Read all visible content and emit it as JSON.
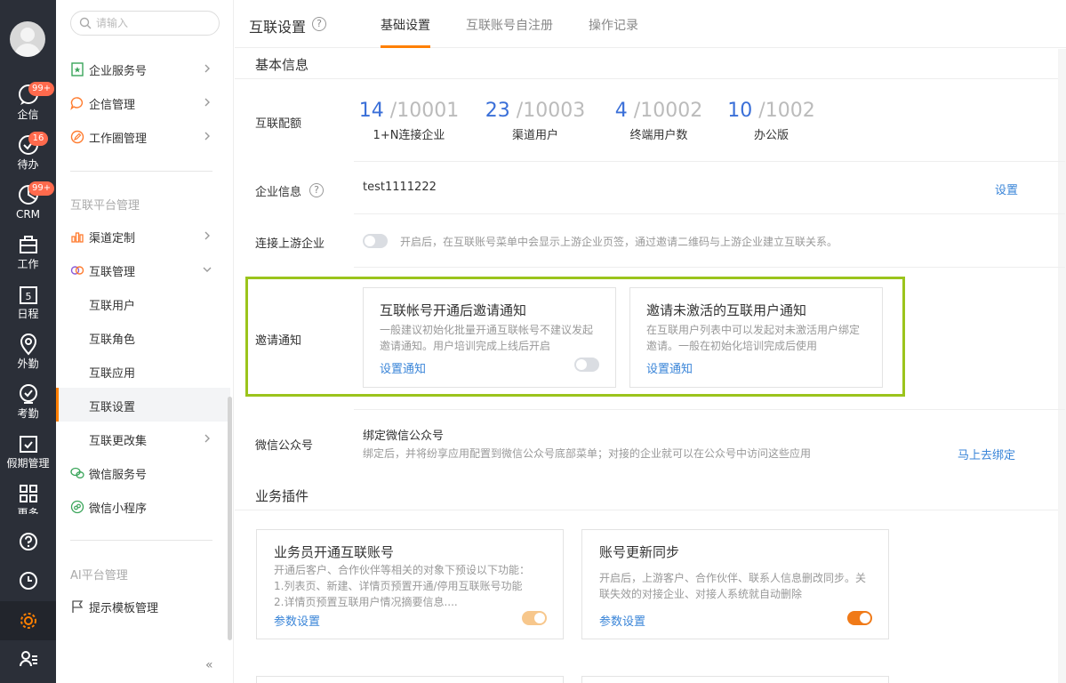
{
  "rail": {
    "items": [
      {
        "label": "企信",
        "badge": "99+"
      },
      {
        "label": "待办",
        "badge": "16"
      },
      {
        "label": "CRM",
        "badge": "99+"
      },
      {
        "label": "工作"
      },
      {
        "label": "日程",
        "day": "5"
      },
      {
        "label": "外勤"
      },
      {
        "label": "考勤"
      },
      {
        "label": "假期管理"
      },
      {
        "label": "更多"
      }
    ]
  },
  "sidebar": {
    "search_placeholder": "请输入",
    "items": [
      {
        "label": "企业服务号"
      },
      {
        "label": "企信管理"
      },
      {
        "label": "工作圈管理"
      }
    ],
    "group1_title": "互联平台管理",
    "group1": [
      {
        "label": "渠道定制"
      },
      {
        "label": "互联管理"
      },
      {
        "label": "互联用户"
      },
      {
        "label": "互联角色"
      },
      {
        "label": "互联应用"
      },
      {
        "label": "互联设置"
      },
      {
        "label": "互联更改集"
      },
      {
        "label": "微信服务号"
      },
      {
        "label": "微信小程序"
      }
    ],
    "group2_title": "AI平台管理",
    "group2": [
      {
        "label": "提示模板管理"
      }
    ],
    "collapse": "«"
  },
  "header": {
    "title": "互联设置",
    "tabs": [
      "基础设置",
      "互联账号自注册",
      "操作记录"
    ]
  },
  "basic": {
    "section_title": "基本信息",
    "quota_label": "互联配额",
    "quotas": [
      {
        "used": "14",
        "total": " /10001",
        "caption": "1+N连接企业"
      },
      {
        "used": "23",
        "total": " /10003",
        "caption": "渠道用户"
      },
      {
        "used": "4",
        "total": " /10002",
        "caption": "终端用户数"
      },
      {
        "used": "10",
        "total": " /1002",
        "caption": "办公版"
      }
    ],
    "company_label": "企业信息",
    "company_value": "test1111222",
    "company_action": "设置",
    "upstream_label": "连接上游企业",
    "upstream_hint": "开启后，在互联账号菜单中会显示上游企业页签，通过邀请二维码与上游企业建立互联关系。",
    "invite_label": "邀请通知",
    "invite_cards": [
      {
        "title": "互联帐号开通后邀请通知",
        "desc1": "一般建议初始化批量开通互联帐号不建议发起",
        "desc2": "邀请通知。用户培训完成上线后开启",
        "link": "设置通知"
      },
      {
        "title": "邀请未激活的互联用户通知",
        "desc1": "在互联用户列表中可以发起对未激活用户绑定",
        "desc2": "邀请。一般在初始化培训完成后使用",
        "link": "设置通知"
      }
    ],
    "wechat_label": "微信公众号",
    "wechat_title": "绑定微信公众号",
    "wechat_hint": "绑定后，并将纷享应用配置到微信公众号底部菜单；对接的企业就可以在公众号中访问这些应用",
    "wechat_action": "马上去绑定"
  },
  "plugins": {
    "section_title": "业务插件",
    "cards": [
      {
        "title": "业务员开通互联账号",
        "desc": [
          "开通后客户、合作伙伴等相关的对象下预设以下功能：",
          "1.列表页、新建、详情页预置开通/停用互联账号功能",
          "2.详情页预置互联用户情况摘要信息...."
        ],
        "link": "参数设置"
      },
      {
        "title": "账号更新同步",
        "desc": [
          "开启后，上游客户、合作伙伴、联系人信息删改同步。关",
          "联失效的对接企业、对接人系统就自动删除"
        ],
        "link": "参数设置"
      }
    ]
  },
  "colors": {
    "accent": "#ff8000",
    "link": "#3a85d8",
    "number": "#3a6fd8",
    "highlight": "#9bc41c",
    "rail": "#2b2f38"
  }
}
